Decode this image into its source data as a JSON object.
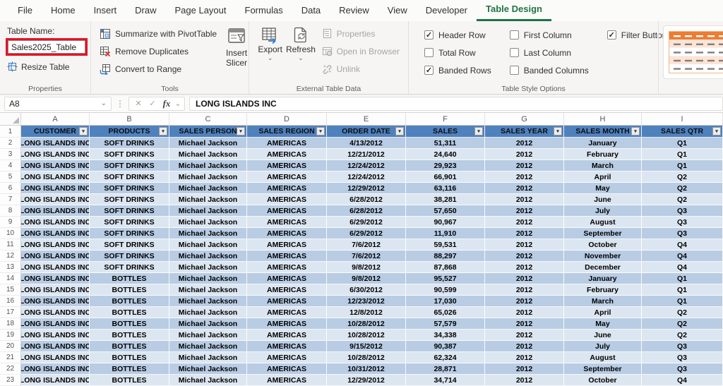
{
  "tabs": [
    {
      "label": "File",
      "active": false
    },
    {
      "label": "Home",
      "active": false
    },
    {
      "label": "Insert",
      "active": false
    },
    {
      "label": "Draw",
      "active": false
    },
    {
      "label": "Page Layout",
      "active": false
    },
    {
      "label": "Formulas",
      "active": false
    },
    {
      "label": "Data",
      "active": false
    },
    {
      "label": "Review",
      "active": false
    },
    {
      "label": "View",
      "active": false
    },
    {
      "label": "Developer",
      "active": false
    },
    {
      "label": "Table Design",
      "active": true
    }
  ],
  "colors": {
    "accent_green": "#217346",
    "annotation_red": "#e81123",
    "table_header_fill": "#4f81bd",
    "band_dark": "#b8cce4",
    "band_light": "#dce6f1",
    "gallery_orange": "#ed7d31",
    "gallery_dark": "#1a1a1a"
  },
  "ribbon": {
    "properties": {
      "table_name_label": "Table Name:",
      "table_name_value": "Sales2025_Table",
      "resize_label": "Resize Table",
      "group_label": "Properties"
    },
    "tools": {
      "buttons": [
        {
          "label": "Summarize with PivotTable",
          "icon": "pivottable-icon"
        },
        {
          "label": "Remove Duplicates",
          "icon": "remove-duplicates-icon"
        },
        {
          "label": "Convert to Range",
          "icon": "convert-to-range-icon"
        }
      ],
      "insert_slicer_label": "Insert Slicer",
      "group_label": "Tools"
    },
    "external": {
      "export_label": "Export",
      "refresh_label": "Refresh",
      "disabled_items": [
        {
          "label": "Properties",
          "icon": "properties-icon"
        },
        {
          "label": "Open in Browser",
          "icon": "open-in-browser-icon"
        },
        {
          "label": "Unlink",
          "icon": "unlink-icon"
        }
      ],
      "group_label": "External Table Data"
    },
    "style_options": {
      "checkboxes": [
        {
          "label": "Header Row",
          "checked": true
        },
        {
          "label": "Total Row",
          "checked": false
        },
        {
          "label": "Banded Rows",
          "checked": true
        },
        {
          "label": "First Column",
          "checked": false
        },
        {
          "label": "Last Column",
          "checked": false
        },
        {
          "label": "Banded Columns",
          "checked": false
        },
        {
          "label": "Filter Button",
          "checked": true
        }
      ],
      "group_label": "Table Style Options"
    }
  },
  "formula_bar": {
    "name_box": "A8",
    "cancel_glyph": "✕",
    "enter_glyph": "✓",
    "fx_label": "fx",
    "formula": "LONG ISLANDS INC"
  },
  "sheet": {
    "column_letters": [
      "A",
      "B",
      "C",
      "D",
      "E",
      "F",
      "G",
      "H",
      "I"
    ],
    "columns": [
      "CUSTOMER",
      "PRODUCTS",
      "SALES PERSON",
      "SALES REGION",
      "ORDER DATE",
      "SALES",
      "SALES YEAR",
      "SALES MONTH",
      "SALES QTR"
    ],
    "first_data_row_number": 2,
    "rows": [
      [
        "LONG ISLANDS INC",
        "SOFT DRINKS",
        "Michael Jackson",
        "AMERICAS",
        "4/13/2012",
        "51,311",
        "2012",
        "January",
        "Q1"
      ],
      [
        "LONG ISLANDS INC",
        "SOFT DRINKS",
        "Michael Jackson",
        "AMERICAS",
        "12/21/2012",
        "24,640",
        "2012",
        "February",
        "Q1"
      ],
      [
        "LONG ISLANDS INC",
        "SOFT DRINKS",
        "Michael Jackson",
        "AMERICAS",
        "12/24/2012",
        "29,923",
        "2012",
        "March",
        "Q1"
      ],
      [
        "LONG ISLANDS INC",
        "SOFT DRINKS",
        "Michael Jackson",
        "AMERICAS",
        "12/24/2012",
        "66,901",
        "2012",
        "April",
        "Q2"
      ],
      [
        "LONG ISLANDS INC",
        "SOFT DRINKS",
        "Michael Jackson",
        "AMERICAS",
        "12/29/2012",
        "63,116",
        "2012",
        "May",
        "Q2"
      ],
      [
        "LONG ISLANDS INC",
        "SOFT DRINKS",
        "Michael Jackson",
        "AMERICAS",
        "6/28/2012",
        "38,281",
        "2012",
        "June",
        "Q2"
      ],
      [
        "LONG ISLANDS INC",
        "SOFT DRINKS",
        "Michael Jackson",
        "AMERICAS",
        "6/28/2012",
        "57,650",
        "2012",
        "July",
        "Q3"
      ],
      [
        "LONG ISLANDS INC",
        "SOFT DRINKS",
        "Michael Jackson",
        "AMERICAS",
        "6/29/2012",
        "90,967",
        "2012",
        "August",
        "Q3"
      ],
      [
        "LONG ISLANDS INC",
        "SOFT DRINKS",
        "Michael Jackson",
        "AMERICAS",
        "6/29/2012",
        "11,910",
        "2012",
        "September",
        "Q3"
      ],
      [
        "LONG ISLANDS INC",
        "SOFT DRINKS",
        "Michael Jackson",
        "AMERICAS",
        "7/6/2012",
        "59,531",
        "2012",
        "October",
        "Q4"
      ],
      [
        "LONG ISLANDS INC",
        "SOFT DRINKS",
        "Michael Jackson",
        "AMERICAS",
        "7/6/2012",
        "88,297",
        "2012",
        "November",
        "Q4"
      ],
      [
        "LONG ISLANDS INC",
        "SOFT DRINKS",
        "Michael Jackson",
        "AMERICAS",
        "9/8/2012",
        "87,868",
        "2012",
        "December",
        "Q4"
      ],
      [
        "LONG ISLANDS INC",
        "BOTTLES",
        "Michael Jackson",
        "AMERICAS",
        "9/8/2012",
        "95,527",
        "2012",
        "January",
        "Q1"
      ],
      [
        "LONG ISLANDS INC",
        "BOTTLES",
        "Michael Jackson",
        "AMERICAS",
        "6/30/2012",
        "90,599",
        "2012",
        "February",
        "Q1"
      ],
      [
        "LONG ISLANDS INC",
        "BOTTLES",
        "Michael Jackson",
        "AMERICAS",
        "12/23/2012",
        "17,030",
        "2012",
        "March",
        "Q1"
      ],
      [
        "LONG ISLANDS INC",
        "BOTTLES",
        "Michael Jackson",
        "AMERICAS",
        "12/8/2012",
        "65,026",
        "2012",
        "April",
        "Q2"
      ],
      [
        "LONG ISLANDS INC",
        "BOTTLES",
        "Michael Jackson",
        "AMERICAS",
        "10/28/2012",
        "57,579",
        "2012",
        "May",
        "Q2"
      ],
      [
        "LONG ISLANDS INC",
        "BOTTLES",
        "Michael Jackson",
        "AMERICAS",
        "10/28/2012",
        "34,338",
        "2012",
        "June",
        "Q2"
      ],
      [
        "LONG ISLANDS INC",
        "BOTTLES",
        "Michael Jackson",
        "AMERICAS",
        "9/15/2012",
        "90,387",
        "2012",
        "July",
        "Q3"
      ],
      [
        "LONG ISLANDS INC",
        "BOTTLES",
        "Michael Jackson",
        "AMERICAS",
        "10/28/2012",
        "62,324",
        "2012",
        "August",
        "Q3"
      ],
      [
        "LONG ISLANDS INC",
        "BOTTLES",
        "Michael Jackson",
        "AMERICAS",
        "10/31/2012",
        "28,871",
        "2012",
        "September",
        "Q3"
      ],
      [
        "LONG ISLANDS INC",
        "BOTTLES",
        "Michael Jackson",
        "AMERICAS",
        "12/29/2012",
        "34,714",
        "2012",
        "October",
        "Q4"
      ]
    ]
  }
}
